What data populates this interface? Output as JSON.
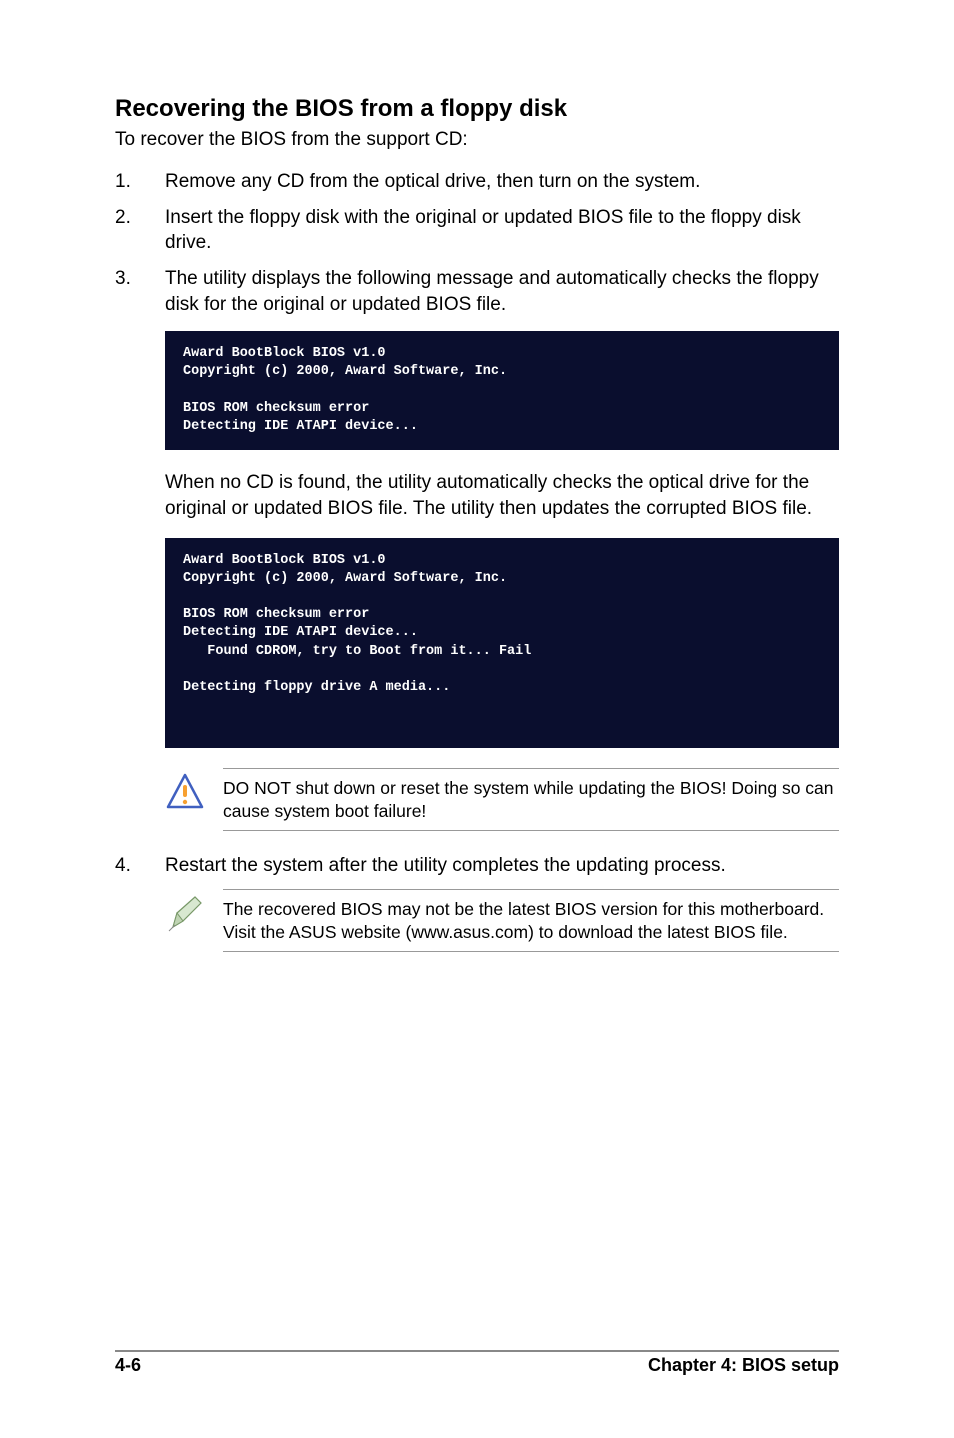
{
  "heading": "Recovering the BIOS from a floppy disk",
  "subheading": "To recover the BIOS from the support CD:",
  "steps": {
    "1": {
      "num": "1.",
      "text": "Remove any CD from the optical drive, then turn on the system."
    },
    "2": {
      "num": "2.",
      "text": "Insert the floppy disk with the original or updated BIOS file to the floppy disk drive."
    },
    "3": {
      "num": "3.",
      "text": "The utility displays the following message and automatically checks the floppy disk for the original or updated BIOS file."
    },
    "4": {
      "num": "4.",
      "text": "Restart the system after the utility completes the updating process."
    }
  },
  "terminal1": "Award BootBlock BIOS v1.0\nCopyright (c) 2000, Award Software, Inc.\n\nBIOS ROM checksum error\nDetecting IDE ATAPI device...\n",
  "afterTerm1": "When no CD is found, the utility automatically checks the optical drive for the original or updated BIOS file. The utility then updates the corrupted BIOS file.",
  "terminal2": "Award BootBlock BIOS v1.0\nCopyright (c) 2000, Award Software, Inc.\n\nBIOS ROM checksum error\nDetecting IDE ATAPI device...\n   Found CDROM, try to Boot from it... Fail\n\nDetecting floppy drive A media...\n\n\n",
  "warn": "DO NOT shut down or reset the system while updating the BIOS! Doing so can cause system boot failure!",
  "note": "The recovered BIOS may not be the latest BIOS version for this motherboard. Visit the ASUS website (www.asus.com) to download the latest BIOS file.",
  "footer": {
    "page": "4-6",
    "chapter": "Chapter 4: BIOS setup"
  }
}
